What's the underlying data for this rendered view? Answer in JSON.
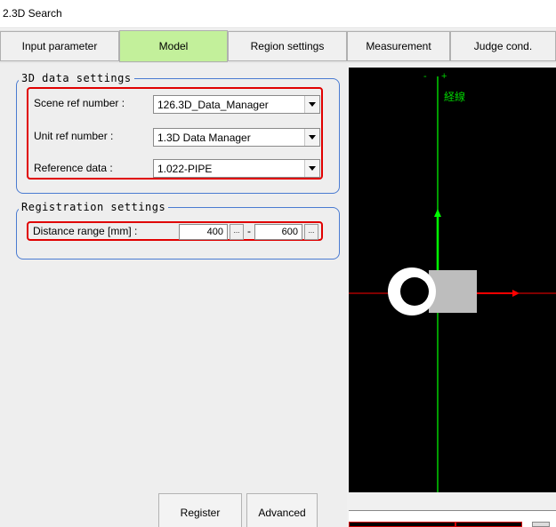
{
  "window": {
    "title": "2.3D Search"
  },
  "tabs": [
    {
      "label": "Input parameter",
      "active": false
    },
    {
      "label": "Model",
      "active": true
    },
    {
      "label": "Region settings",
      "active": false
    },
    {
      "label": "Measurement",
      "active": false
    },
    {
      "label": "Judge cond.",
      "active": false
    }
  ],
  "data_settings": {
    "title": "3D data settings",
    "scene_ref": {
      "label": "Scene ref number :",
      "value": "126.3D_Data_Manager"
    },
    "unit_ref": {
      "label": "Unit ref number :",
      "value": "1.3D Data Manager"
    },
    "reference": {
      "label": "Reference data :",
      "value": "1.022-PIPE"
    }
  },
  "registration": {
    "title": "Registration settings",
    "distance": {
      "label": "Distance range [mm] :",
      "min": "400",
      "max": "600",
      "dots": "...",
      "separator": "-"
    }
  },
  "buttons": {
    "register": "Register",
    "advanced": "Advanced"
  },
  "viewer": {
    "axis_minus": "-",
    "axis_plus": "+",
    "axis_label": "経線"
  },
  "colors": {
    "active_tab": "#c3f09b",
    "group_border": "#4a7bd1",
    "highlight": "#e00000",
    "axis": "#00d000",
    "x_axis": "#ff0000"
  }
}
